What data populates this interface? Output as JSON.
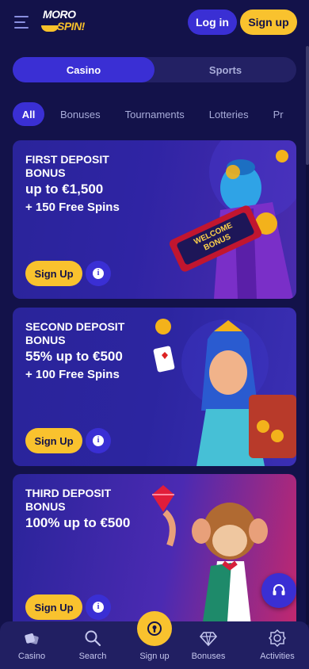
{
  "header": {
    "logo_top": "MORO",
    "logo_bottom": "SPIN!",
    "login_label": "Log in",
    "signup_label": "Sign up"
  },
  "switch": {
    "options": [
      {
        "label": "Casino",
        "active": true
      },
      {
        "label": "Sports",
        "active": false
      }
    ]
  },
  "categories": [
    {
      "label": "All",
      "active": true
    },
    {
      "label": "Bonuses"
    },
    {
      "label": "Tournaments"
    },
    {
      "label": "Lotteries"
    },
    {
      "label": "Pr"
    }
  ],
  "cards": [
    {
      "title": "FIRST DEPOSIT BONUS",
      "amount": "up to €1,500",
      "extra": "+ 150 Free Spins",
      "cta": "Sign Up",
      "banner_text": "WELCOME BONUS"
    },
    {
      "title": "SECOND DEPOSIT BONUS",
      "amount": "55% up to €500",
      "extra": "+ 100 Free Spins",
      "cta": "Sign Up"
    },
    {
      "title": "THIRD DEPOSIT BONUS",
      "amount": "100% up to €500",
      "extra": "",
      "cta": "Sign Up"
    }
  ],
  "bottom_nav": [
    {
      "label": "Casino",
      "icon": "dice-icon"
    },
    {
      "label": "Search",
      "icon": "search-icon"
    },
    {
      "label": "Sign up",
      "icon": "keyhole-icon"
    },
    {
      "label": "Bonuses",
      "icon": "diamond-icon"
    },
    {
      "label": "Activities",
      "icon": "badge-icon"
    }
  ],
  "colors": {
    "background": "#13124a",
    "primary": "#3a2fd4",
    "accent": "#f9c22e",
    "nav": "#211f62"
  }
}
